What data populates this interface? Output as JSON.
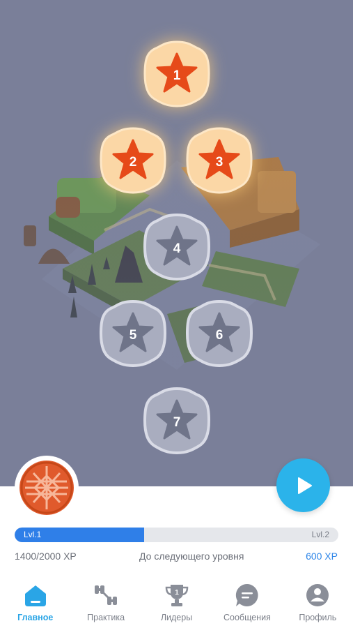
{
  "levels": [
    {
      "number": "1",
      "state": "completed"
    },
    {
      "number": "2",
      "state": "completed"
    },
    {
      "number": "3",
      "state": "completed"
    },
    {
      "number": "4",
      "state": "locked"
    },
    {
      "number": "5",
      "state": "locked"
    },
    {
      "number": "6",
      "state": "locked"
    },
    {
      "number": "7",
      "state": "locked"
    }
  ],
  "progress": {
    "current_level": "Lvl.1",
    "next_level": "Lvl.2",
    "xp_current": "1400/2000 XP",
    "caption": "До следующего уровня",
    "xp_needed": "600 XP",
    "fill_fraction": 0.4
  },
  "tabs": [
    {
      "label": "Главное",
      "icon": "home-icon",
      "active": true
    },
    {
      "label": "Практика",
      "icon": "dumbbell-icon",
      "active": false
    },
    {
      "label": "Лидеры",
      "icon": "trophy-icon",
      "active": false
    },
    {
      "label": "Сообщения",
      "icon": "chat-icon",
      "active": false
    },
    {
      "label": "Профиль",
      "icon": "profile-icon",
      "active": false
    }
  ],
  "colors": {
    "map_background": "#7a7f99",
    "accent_blue": "#2bb3ea",
    "progress_blue": "#2f7fe8",
    "star_completed": "#e64a19",
    "badge_completed": "#fbd7a6",
    "star_locked": "#6f7489",
    "badge_locked": "#a9adbf",
    "avatar_orange": "#e05a2c"
  }
}
